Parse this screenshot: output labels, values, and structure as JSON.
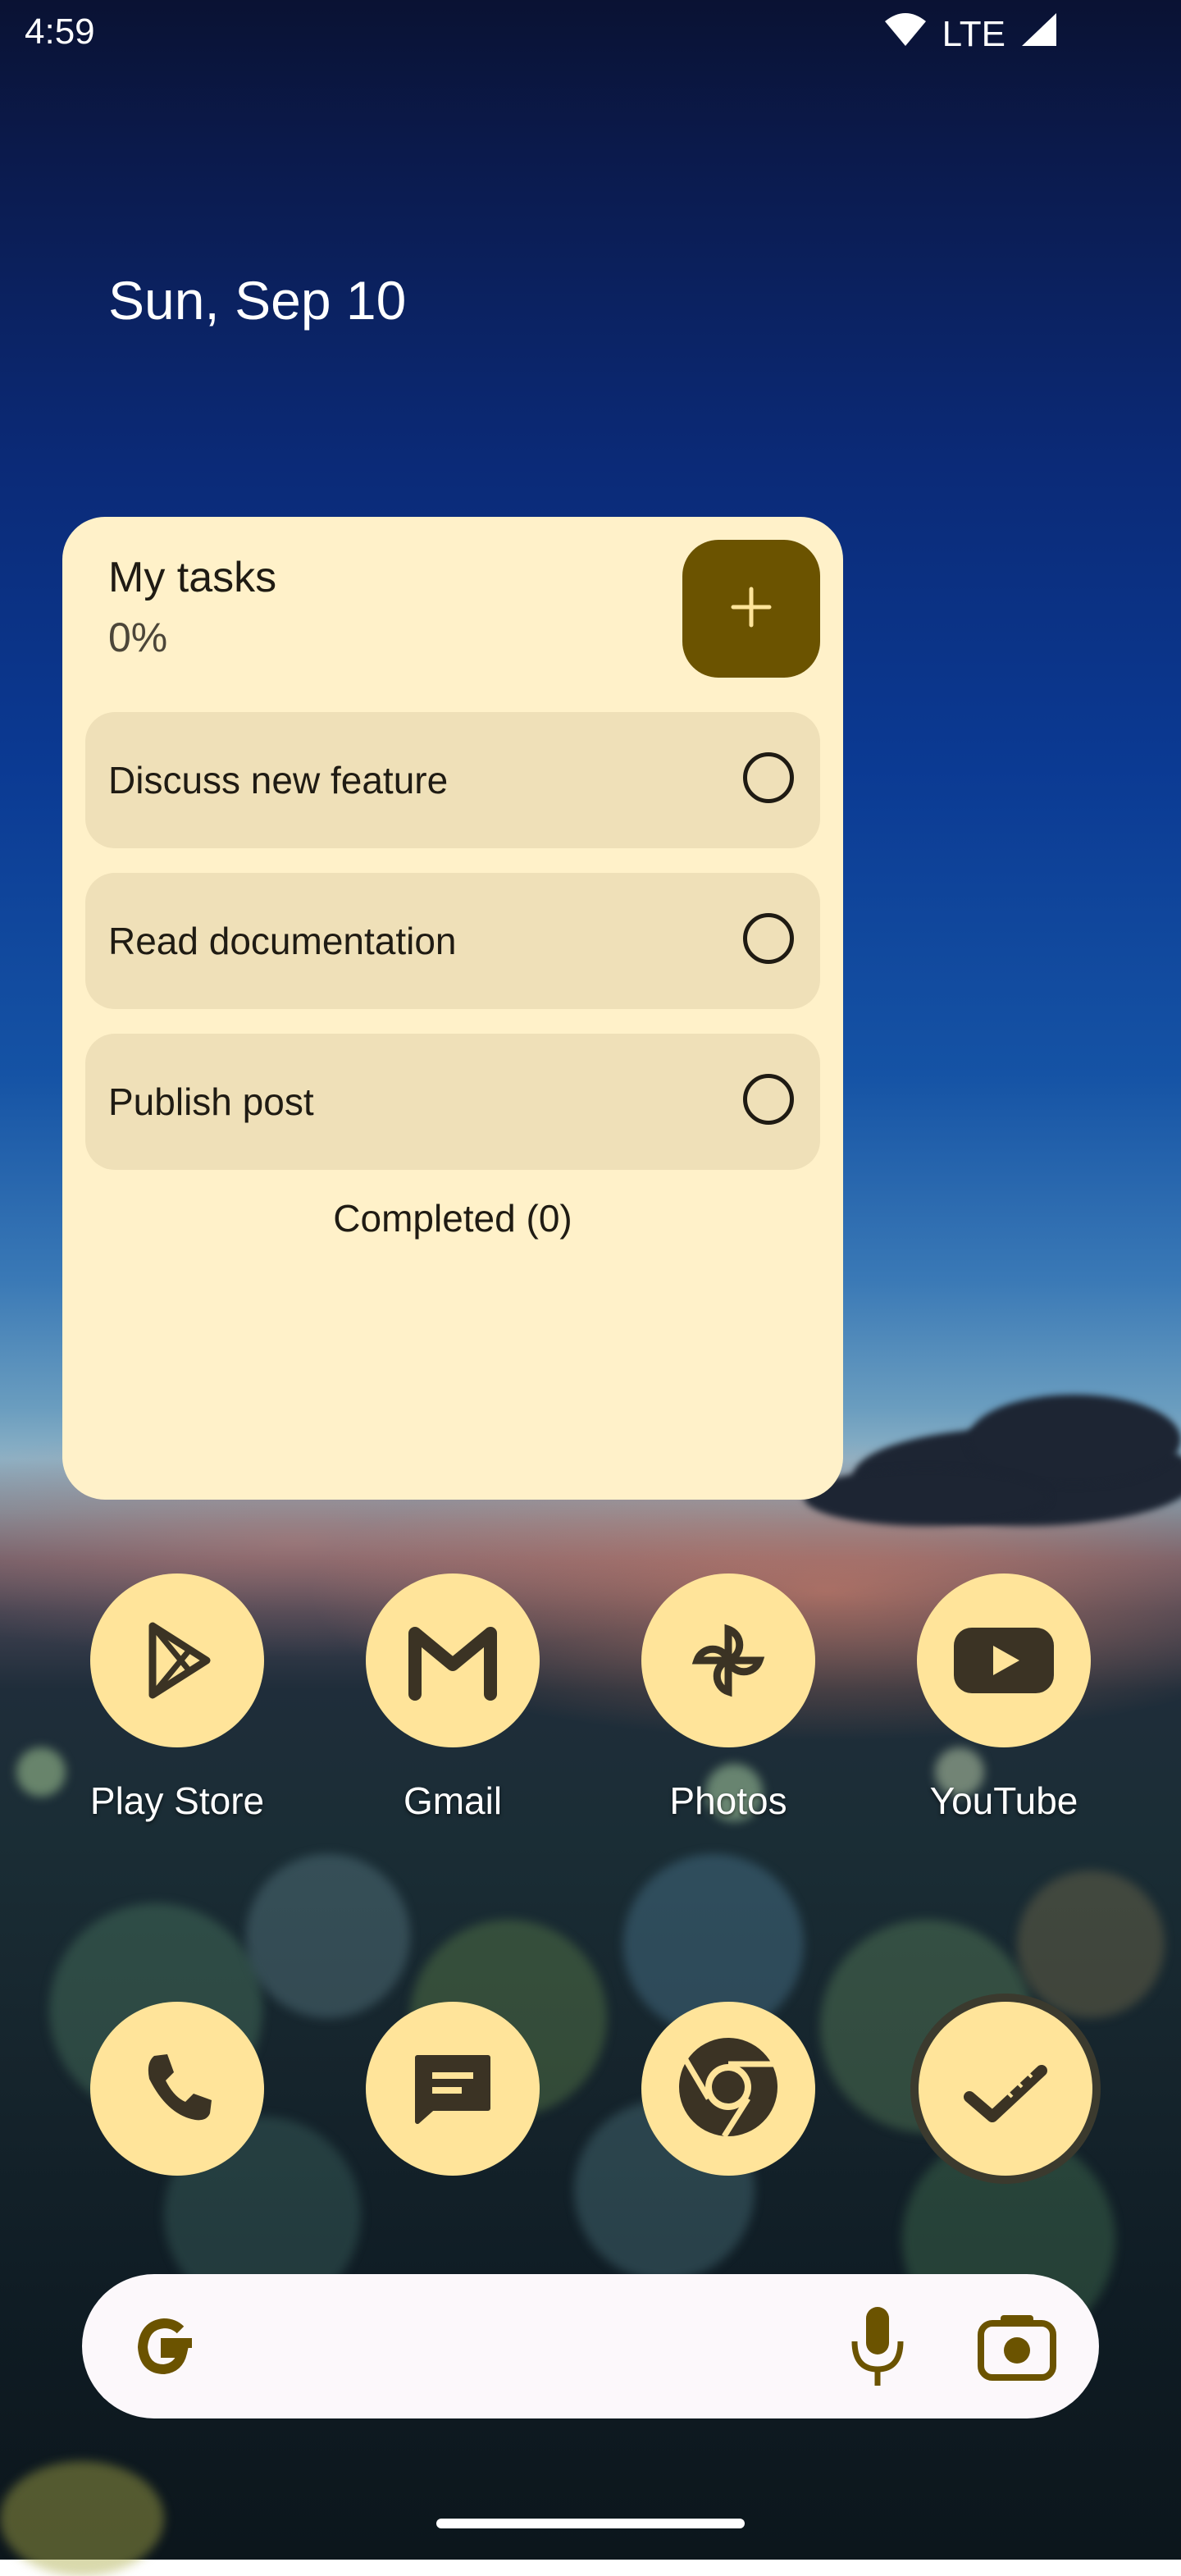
{
  "status_bar": {
    "time": "4:59",
    "network": "LTE",
    "icons": [
      "wifi-icon",
      "cell-signal-icon"
    ]
  },
  "date": "Sun, Sep 10",
  "tasks_widget": {
    "title": "My tasks",
    "progress": "0%",
    "add_icon": "plus-icon",
    "tasks": [
      {
        "label": "Discuss new feature"
      },
      {
        "label": "Read documentation"
      },
      {
        "label": "Publish post"
      }
    ],
    "completed": "Completed (0)"
  },
  "apps": [
    {
      "label": "Play Store",
      "icon": "play-store-icon"
    },
    {
      "label": "Gmail",
      "icon": "gmail-icon"
    },
    {
      "label": "Photos",
      "icon": "photos-icon"
    },
    {
      "label": "YouTube",
      "icon": "youtube-icon"
    }
  ],
  "dock": [
    {
      "icon": "phone-icon"
    },
    {
      "icon": "messages-icon"
    },
    {
      "icon": "chrome-icon"
    },
    {
      "icon": "tasks-app-icon"
    }
  ],
  "search": {
    "icons": [
      "google-g-icon",
      "mic-icon",
      "lens-camera-icon"
    ]
  },
  "colors": {
    "widget_bg": "#fff1c9",
    "task_bg": "#efe0b8",
    "accent": "#6b5300",
    "icon_bg": "#ffe49a"
  }
}
